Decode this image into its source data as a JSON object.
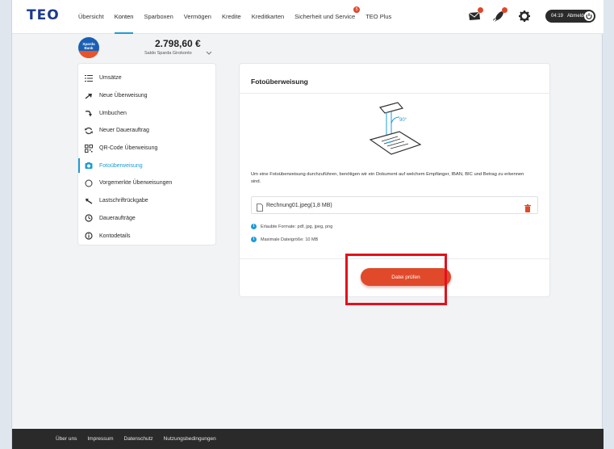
{
  "header": {
    "logo": "TEO",
    "nav": [
      {
        "label": "Übersicht",
        "name": "nav-uebersicht"
      },
      {
        "label": "Konten",
        "name": "nav-konten",
        "active": true
      },
      {
        "label": "Sparboxen",
        "name": "nav-sparboxen"
      },
      {
        "label": "Vermögen",
        "name": "nav-vermoegen"
      },
      {
        "label": "Kredite",
        "name": "nav-kredite"
      },
      {
        "label": "Kreditkarten",
        "name": "nav-kreditkarten"
      },
      {
        "label": "Sicherheit und Service",
        "name": "nav-sicherheit",
        "badge": "5"
      },
      {
        "label": "TEO Plus",
        "name": "nav-teo-plus"
      }
    ],
    "session_time": "04:19",
    "logout_label": "Abmelden",
    "icons": [
      "mail-icon",
      "rocket-icon",
      "gear-icon"
    ]
  },
  "account": {
    "bank_logo_text": "Sparda Bank",
    "balance": "2.798,60 €",
    "name": "Saldo Sparda Girokonto"
  },
  "sidebar": {
    "items": [
      {
        "label": "Umsätze",
        "icon": "list-icon"
      },
      {
        "label": "Neue Überweisung",
        "icon": "arrow-right-icon"
      },
      {
        "label": "Umbuchen",
        "icon": "curved-arrow-icon"
      },
      {
        "label": "Neuer Dauerauftrag",
        "icon": "repeat-icon"
      },
      {
        "label": "QR-Code Überweisung",
        "icon": "qr-code-icon"
      },
      {
        "label": "Fotoüberweisung",
        "icon": "camera-icon",
        "active": true
      },
      {
        "label": "Vorgemerkte Überweisungen",
        "icon": "circle-icon"
      },
      {
        "label": "Lastschriftrückgabe",
        "icon": "arrow-left-icon"
      },
      {
        "label": "Daueraufträge",
        "icon": "clock-icon"
      },
      {
        "label": "Kontodetails",
        "icon": "info-icon"
      }
    ]
  },
  "card": {
    "title": "Fotoüberweisung",
    "illustration_angle": "90°",
    "description": "Um eine Fotoüberweisung durchzuführen, benötigen wir ein Dokument auf welchem Empfänger, IBAN, BIC und Betrag zu erkennen sind.",
    "file_name": "Rechnung01.jpeg(1,8 MB)",
    "formats_info": "Erlaubte Formate: pdf, jpg, jpeg, png",
    "size_info": "Maximale Dateigröße: 10 MB",
    "submit_label": "Datei prüfen"
  },
  "footer": {
    "links": [
      "Über uns",
      "Impressum",
      "Datenschutz",
      "Nutzungsbedingungen"
    ]
  },
  "colors": {
    "accent": "#1f9cd6",
    "action": "#e0492a",
    "highlight": "#e5101a",
    "footer": "#2a2a2a"
  }
}
